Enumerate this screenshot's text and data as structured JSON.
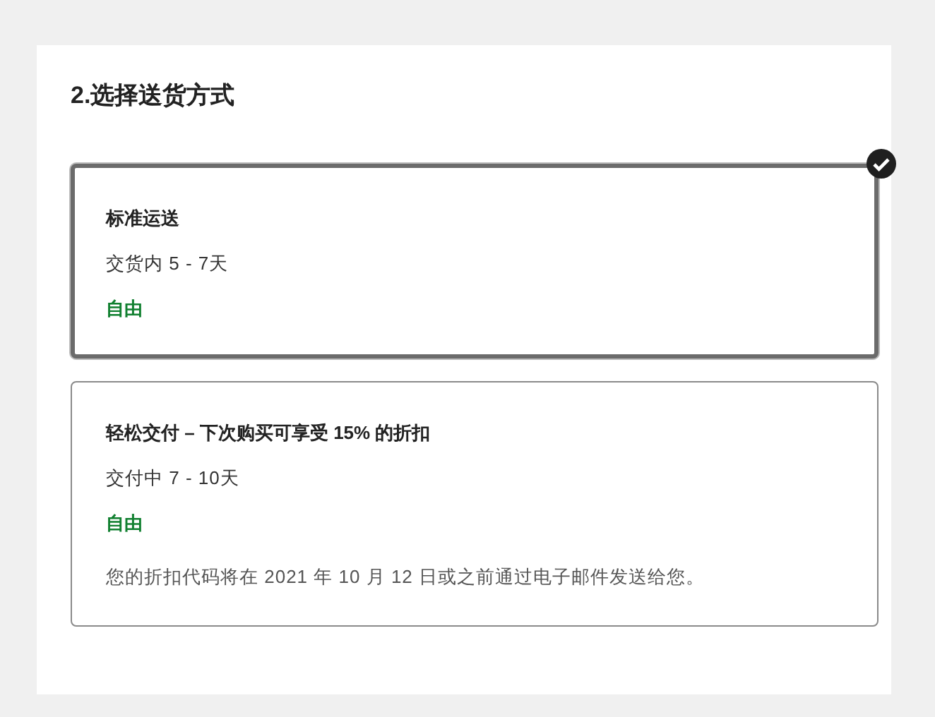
{
  "title": "2.选择送货方式",
  "options": [
    {
      "name": "标准运送",
      "timing": "交货内 5 - 7天",
      "price": "自由",
      "selected": true
    },
    {
      "name": "轻松交付 – 下次购买可享受 15% 的折扣",
      "timing": "交付中 7 - 10天",
      "price": "自由",
      "note": "您的折扣代码将在 2021 年 10 月 12 日或之前通过电子邮件发送给您。",
      "selected": false
    }
  ]
}
